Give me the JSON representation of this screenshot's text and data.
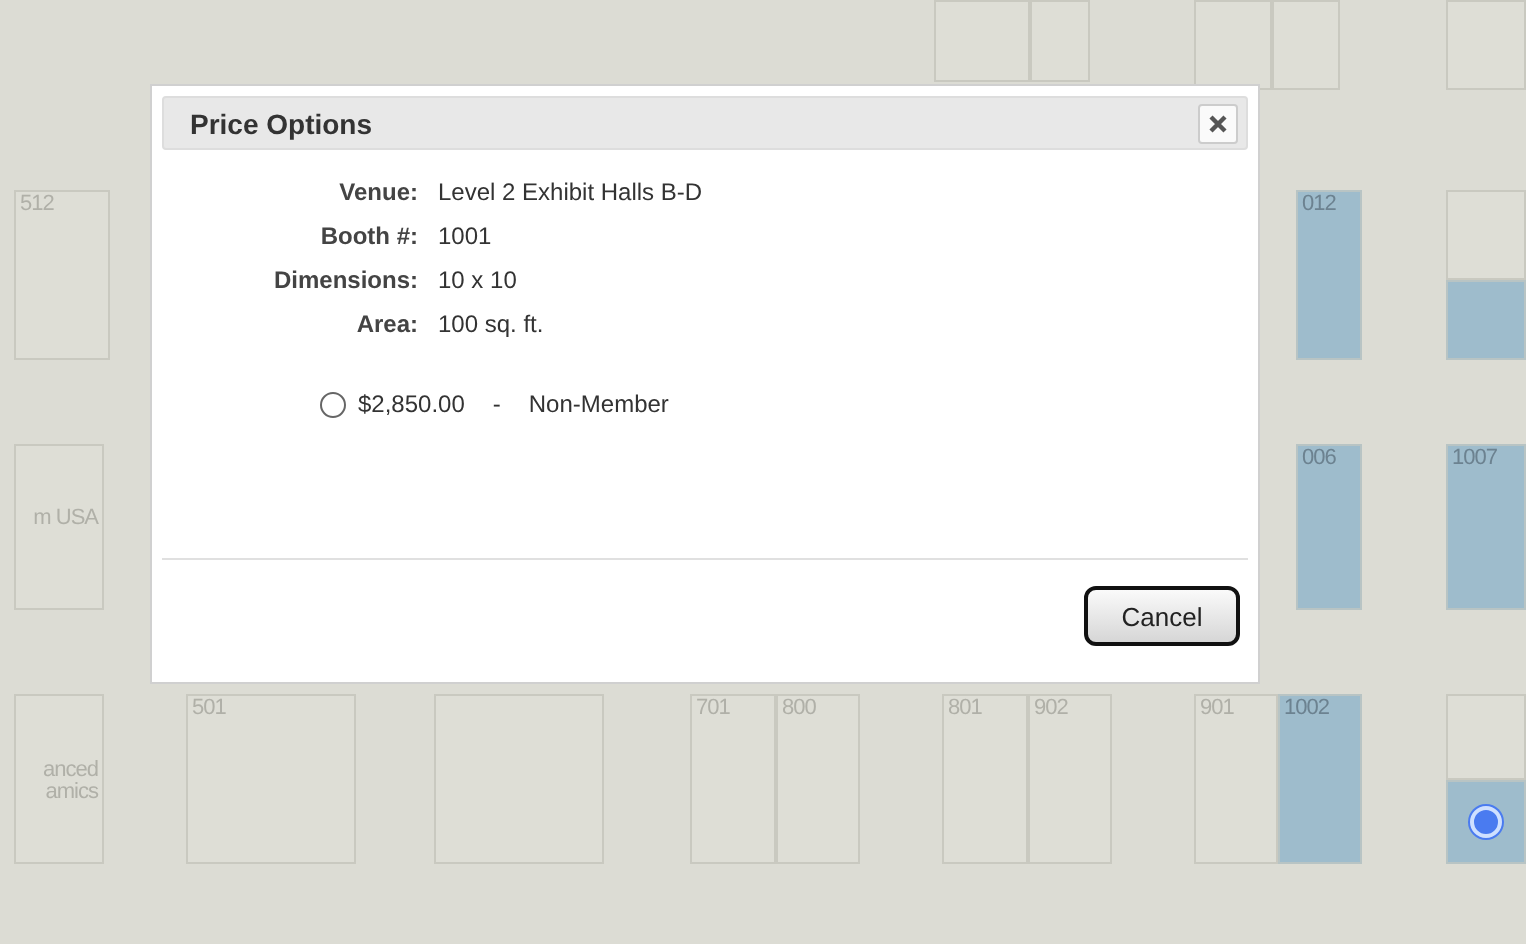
{
  "floor_plan": {
    "booths": [
      {
        "reserved": false,
        "selected": false
      },
      {
        "reserved": false,
        "selected": false
      },
      {
        "reserved": false,
        "selected": false
      },
      {
        "reserved": false,
        "selected": false
      },
      {
        "reserved": false,
        "selected": false
      },
      {
        "label": "512",
        "reserved": false,
        "selected": false
      },
      {
        "label": "012",
        "reserved": true,
        "selected": false
      },
      {
        "reserved": false,
        "selected": false
      },
      {
        "reserved": true,
        "selected": false
      },
      {
        "label": "m USA",
        "reserved": false,
        "selected": false
      },
      {
        "label": "006",
        "reserved": true,
        "selected": false
      },
      {
        "label": "1007",
        "reserved": true,
        "selected": false
      },
      {
        "label": "anced amics",
        "reserved": false,
        "selected": false
      },
      {
        "label": "501",
        "reserved": false,
        "selected": false
      },
      {
        "reserved": false,
        "selected": false
      },
      {
        "label": "701",
        "reserved": false,
        "selected": false
      },
      {
        "label": "800",
        "reserved": false,
        "selected": false
      },
      {
        "label": "801",
        "reserved": false,
        "selected": false
      },
      {
        "label": "902",
        "reserved": false,
        "selected": false
      },
      {
        "label": "901",
        "reserved": false,
        "selected": false
      },
      {
        "label": "1002",
        "reserved": true,
        "selected": false
      },
      {
        "reserved": false,
        "selected": false
      },
      {
        "reserved": true,
        "selected": true
      }
    ]
  },
  "dialog": {
    "title": "Price Options",
    "fields": [
      {
        "label": "Venue:",
        "value": "Level 2 Exhibit Halls B-D"
      },
      {
        "label": "Booth #:",
        "value": "1001"
      },
      {
        "label": "Dimensions:",
        "value": "10 x 10"
      },
      {
        "label": "Area:",
        "value": "100 sq. ft."
      }
    ],
    "price_options": [
      {
        "price": "$2,850.00",
        "separator": "-",
        "member_type": "Non-Member",
        "selected": false
      }
    ],
    "buttons": [
      "Cancel"
    ]
  }
}
